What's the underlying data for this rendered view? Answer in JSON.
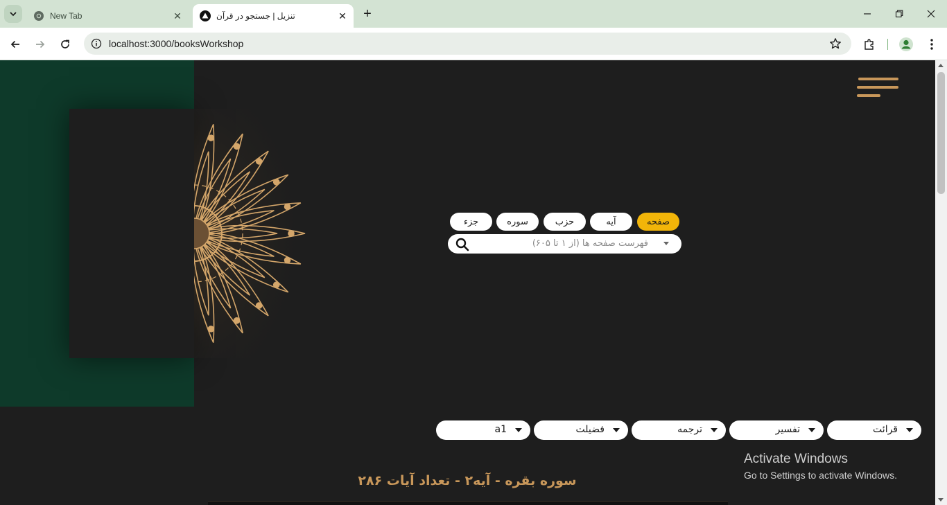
{
  "browser": {
    "tabs": [
      {
        "title": "New Tab",
        "icon": "chrome-icon",
        "active": false
      },
      {
        "title": "تنزیل | جستجو در قرآن",
        "icon": "triangle-logo-icon",
        "active": true
      }
    ],
    "url": "localhost:3000/booksWorkshop"
  },
  "page": {
    "colors": {
      "gold": "#c8975a",
      "accent": "#f2b509",
      "dark": "#1e1e1e",
      "green": "#0e3a2a"
    },
    "search_modes": [
      {
        "label": "صفحه",
        "selected": true
      },
      {
        "label": "آیه",
        "selected": false
      },
      {
        "label": "حزب",
        "selected": false
      },
      {
        "label": "سوره",
        "selected": false
      },
      {
        "label": "جزء",
        "selected": false
      }
    ],
    "search": {
      "placeholder": "فهرست صفحه ها (از ۱ تا ۶۰۵)"
    },
    "dropdowns": [
      {
        "label": "قرائت"
      },
      {
        "label": "تفسیر"
      },
      {
        "label": "ترجمه"
      },
      {
        "label": "فضیلت"
      },
      {
        "label": "a1"
      }
    ],
    "surah_heading": "سوره بقره - آیه۲ - تعداد آیات ۲۸۶"
  },
  "watermark": {
    "title": "Activate Windows",
    "subtitle": "Go to Settings to activate Windows."
  }
}
